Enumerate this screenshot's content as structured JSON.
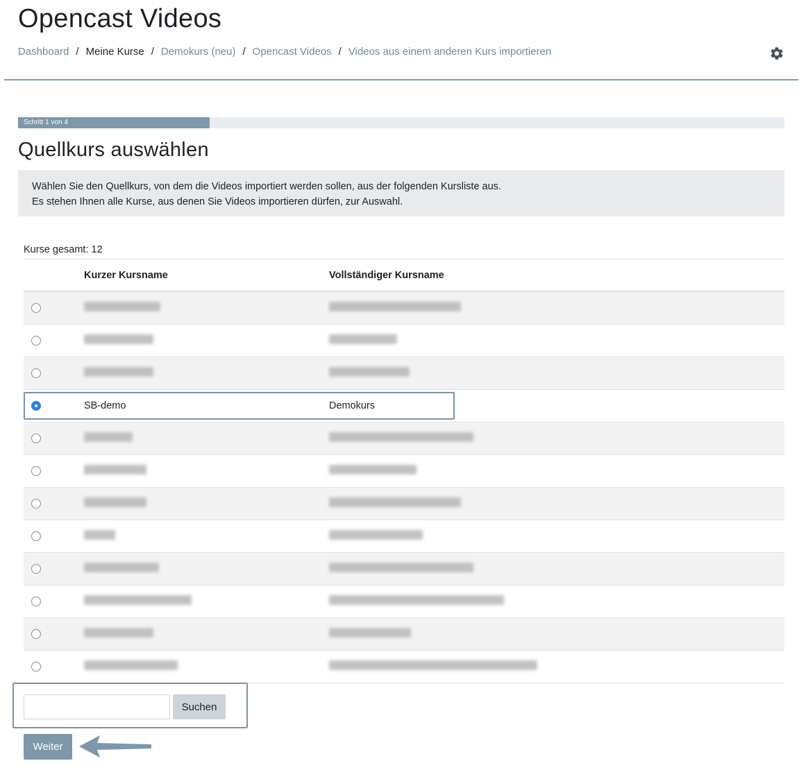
{
  "header": {
    "title": "Opencast Videos",
    "breadcrumb": [
      {
        "label": "Dashboard",
        "link": true
      },
      {
        "label": "Meine Kurse",
        "link": false
      },
      {
        "label": "Demokurs (neu)",
        "link": true
      },
      {
        "label": "Opencast Videos",
        "link": true
      },
      {
        "label": "Videos aus einem anderen Kurs importieren",
        "link": true
      }
    ],
    "settings_icon": "gear-icon"
  },
  "progress": {
    "label": "Schritt 1 von 4",
    "value": 0.25
  },
  "section": {
    "title": "Quellkurs auswählen",
    "info_line1": "Wählen Sie den Quellkurs, von dem die Videos importiert werden sollen, aus der folgenden Kursliste aus.",
    "info_line2": "Es stehen Ihnen alle Kurse, aus denen Sie Videos importieren dürfen, zur Auswahl."
  },
  "table": {
    "total": "Kurse gesamt: 12",
    "headers": {
      "short": "Kurzer Kursname",
      "full": "Vollständiger Kursname"
    },
    "rows": [
      {
        "short": "",
        "full": "",
        "selected": false
      },
      {
        "short": "",
        "full": "",
        "selected": false
      },
      {
        "short": "",
        "full": "",
        "selected": false
      },
      {
        "short": "SB-demo",
        "full": "Demokurs",
        "selected": true
      },
      {
        "short": "",
        "full": "",
        "selected": false
      },
      {
        "short": "",
        "full": "",
        "selected": false
      },
      {
        "short": "",
        "full": "",
        "selected": false
      },
      {
        "short": "",
        "full": "",
        "selected": false
      },
      {
        "short": "",
        "full": "",
        "selected": false
      },
      {
        "short": "",
        "full": "",
        "selected": false
      },
      {
        "short": "",
        "full": "",
        "selected": false
      },
      {
        "short": "",
        "full": "",
        "selected": false
      }
    ]
  },
  "search": {
    "value": "",
    "button_label": "Suchen"
  },
  "next_button_label": "Weiter",
  "colors": {
    "accent": "#7c98aa",
    "radio_selected": "#2f7cf6",
    "link": "#6b8a9c"
  }
}
